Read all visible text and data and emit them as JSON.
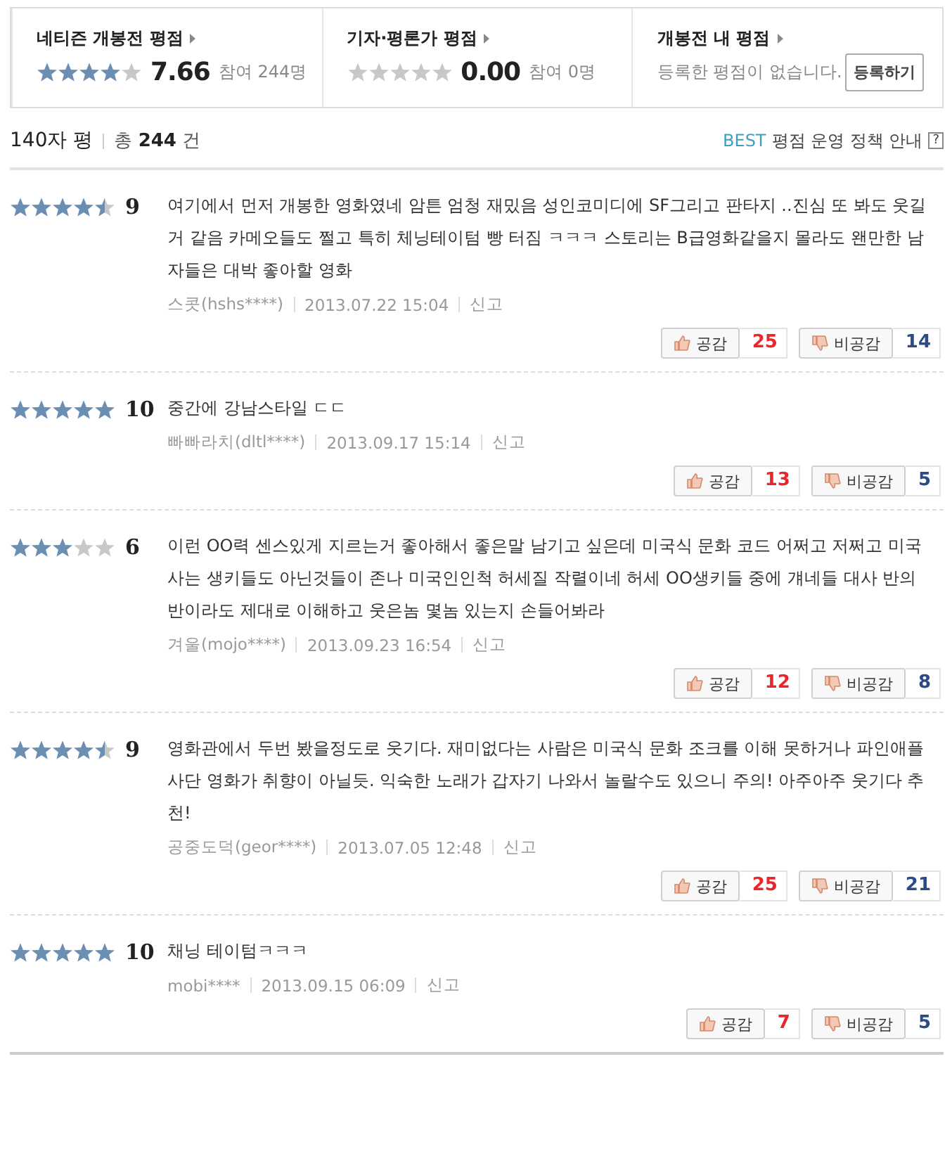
{
  "summary": [
    {
      "kind": "score",
      "title": "네티즌 개봉전 평점",
      "stars": 4,
      "score": "7.66",
      "participants": "참여 244명"
    },
    {
      "kind": "score",
      "title": "기자·평론가 평점",
      "stars": 0,
      "score": "0.00",
      "participants": "참여 0명"
    },
    {
      "kind": "mine",
      "title": "개봉전 내 평점",
      "message": "등록한 평점이 없습니다.",
      "button": "등록하기"
    }
  ],
  "list_header": {
    "title": "140자 평",
    "total": "총 **244** 건",
    "best": "BEST",
    "policy": "평점 운영 정책 안내",
    "help": "?"
  },
  "reviews": [
    {
      "stars": 4.5,
      "score": "9",
      "text": "여기에서 먼저 개봉한 영화였네 암튼 엄청 재밌음 성인코미디에 SF그리고 판타지 ..진심 또 봐도 웃길거 같음 카메오들도 쩔고 특히 체닝테이텀 빵 터짐 ㅋㅋㅋ 스토리는 B급영화같을지 몰라도 왠만한 남자들은 대박 좋아할 영화",
      "author": "스콧(hshs****)",
      "date": "2013.07.22 15:04",
      "report": "신고",
      "like_label": "공감",
      "likes": "25",
      "dislike_label": "비공감",
      "dislikes": "14"
    },
    {
      "stars": 5,
      "score": "10",
      "text": "중간에 강남스타일 ㄷㄷ",
      "author": "빠빠라치(dltl****)",
      "date": "2013.09.17 15:14",
      "report": "신고",
      "like_label": "공감",
      "likes": "13",
      "dislike_label": "비공감",
      "dislikes": "5"
    },
    {
      "stars": 3,
      "score": "6",
      "text": "이런 OO력 센스있게 지르는거 좋아해서 좋은말 남기고 싶은데 미국식 문화 코드 어쩌고 저쩌고 미국 사는 생키들도 아닌것들이 존나 미국인인척 허세질 작렬이네 허세 OO생키들 중에 걔네들 대사 반의 반이라도 제대로 이해하고 웃은놈 몇놈 있는지 손들어봐라",
      "author": "겨울(mojo****)",
      "date": "2013.09.23 16:54",
      "report": "신고",
      "like_label": "공감",
      "likes": "12",
      "dislike_label": "비공감",
      "dislikes": "8"
    },
    {
      "stars": 4.5,
      "score": "9",
      "text": "영화관에서 두번 봤을정도로 웃기다. 재미없다는 사람은 미국식 문화 조크를 이해 못하거나 파인애플사단 영화가 취향이 아닐듯. 익숙한 노래가 갑자기 나와서 놀랄수도 있으니 주의! 아주아주 웃기다 추천!",
      "author": "공중도덕(geor****)",
      "date": "2013.07.05 12:48",
      "report": "신고",
      "like_label": "공감",
      "likes": "25",
      "dislike_label": "비공감",
      "dislikes": "21"
    },
    {
      "stars": 5,
      "score": "10",
      "text": "채닝 테이텀ㅋㅋㅋ",
      "author": "mobi****",
      "date": "2013.09.15 06:09",
      "report": "신고",
      "like_label": "공감",
      "likes": "7",
      "dislike_label": "비공감",
      "dislikes": "5"
    }
  ]
}
